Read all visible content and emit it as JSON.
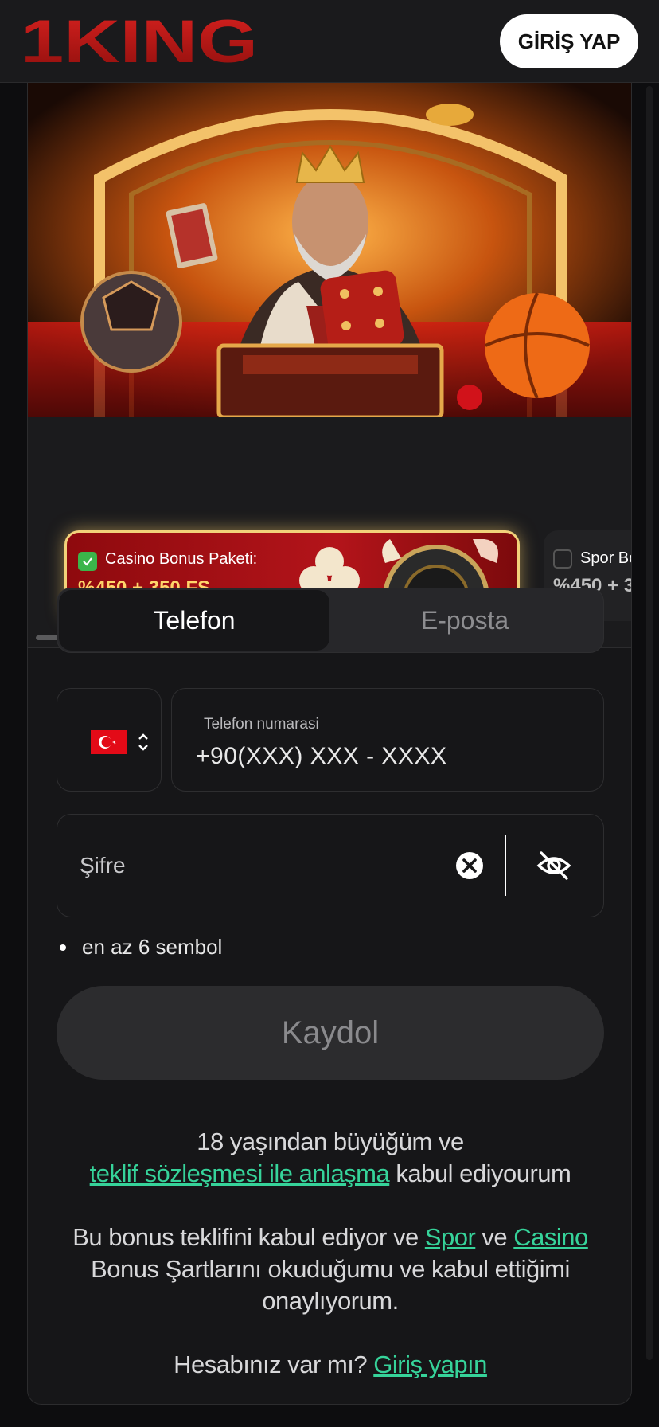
{
  "header": {
    "logo_text": "1KING",
    "login_label": "GİRİŞ YAP"
  },
  "bonuses": [
    {
      "title": "Casino Bonus Paketi:",
      "amount": "%450 + 350 FS",
      "selected": true
    },
    {
      "title": "Spor Bo",
      "amount": "%450 + 3",
      "selected": false
    }
  ],
  "tabs": [
    {
      "label": "Telefon",
      "active": true
    },
    {
      "label": "E-posta",
      "active": false
    }
  ],
  "phone": {
    "label": "Telefon numarasi",
    "value": "+90(XXX) XXX - XXXX",
    "country_flag": "turkey-flag-icon"
  },
  "password": {
    "placeholder": "Şifre"
  },
  "hint": "en az 6 sembol",
  "register_label": "Kaydol",
  "terms": {
    "line1": "18 yaşından büyüğüm ve",
    "link_agreement": "teklif sözleşmesi ile anlaşma",
    "line2_rest": "kabul ediyourum",
    "bonus_prefix": "Bu bonus teklifini kabul ediyor ve",
    "link_spor": "Spor",
    "ve": "ve",
    "link_casino": "Casino",
    "bonus_line2": "Bonus Şartlarını okuduğumu ve kabul ettiğimi",
    "bonus_line3": "onaylıyorum.",
    "account_question": "Hesabınız var mı?",
    "link_login": "Giriş yapın"
  },
  "colors": {
    "accent_green": "#36d39a",
    "brand_red": "#b3141a",
    "bonus_gold": "#ffd66b",
    "background": "#0d0d0f"
  }
}
